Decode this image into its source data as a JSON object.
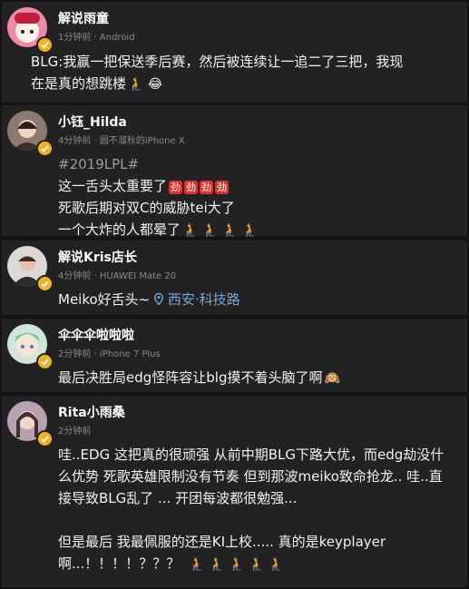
{
  "posts": [
    {
      "name": "解说雨童",
      "meta": "1分钟前 · Android",
      "lines": [
        "BLG:我赢一把保送季后赛，然后被连续让一追二了三把，我现",
        "在是真的想跳楼"
      ],
      "emoji": "🧎 😂"
    },
    {
      "name": "小钰_Hilda",
      "meta": "4分钟前 · 圆不溜秋的iPhone X",
      "tag": "#2019LPL#",
      "lines": [
        "这一舌头太重要了",
        "死歌后期对双C的威胁tei大了",
        "一个大炸的人都晕了"
      ],
      "badges": [
        "劲",
        "劲",
        "劲",
        "劲"
      ],
      "emoji": "🧎 🧎 🧎 🧎"
    },
    {
      "name": "解说Kris店长",
      "meta": "4分钟前 · HUAWEI Mate 20",
      "text": "Meiko好舌头~",
      "location": "西安·科技路",
      "location_icon": "location-pin-icon"
    },
    {
      "name": "伞伞伞啦啦啦",
      "meta": "2分钟前 · iPhone 7 Plus",
      "text": "最后决胜局edg怪阵容让blg摸不着头脑了啊",
      "emoji": "🙉"
    },
    {
      "name": "Rita小雨桑",
      "meta": "2分钟前",
      "lines": [
        "哇..EDG 这把真的很顽强 从前中期BLG下路大优，而edg劫没什",
        "么优势 死歌英雄限制没有节奏 但到那波meiko致命抢龙.. 哇..直",
        "接导致BLG乱了 ... 开团每波都很勉强..."
      ],
      "lines2": [
        "但是最后  我最佩服的还是KI上校..... 真的是keyplayer",
        "啊...！！！！？？？"
      ],
      "emoji": "🧎 🧎 🧎 🧎 🧎"
    }
  ],
  "colors": {
    "background": "#141414",
    "card": "#222222",
    "badge": "#f5b21f",
    "location": "#6fa8dc"
  }
}
